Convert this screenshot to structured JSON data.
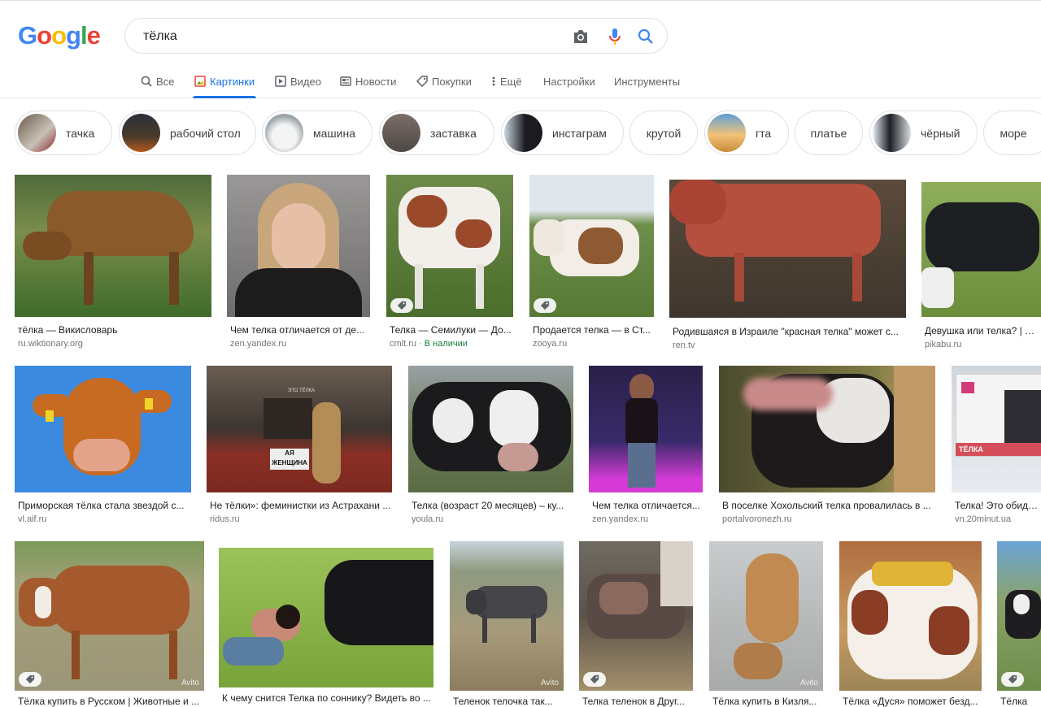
{
  "logo": [
    "G",
    "o",
    "o",
    "g",
    "l",
    "e"
  ],
  "logo_colors": [
    "#4285f4",
    "#ea4335",
    "#fbbc05",
    "#4285f4",
    "#34a853",
    "#ea4335"
  ],
  "search": {
    "query": "тёлка",
    "icons": [
      "camera-icon",
      "mic-icon",
      "search-icon"
    ]
  },
  "tabs": [
    {
      "label": "Все",
      "icon": "search-icon"
    },
    {
      "label": "Картинки",
      "icon": "image-icon",
      "active": true
    },
    {
      "label": "Видео",
      "icon": "video-icon"
    },
    {
      "label": "Новости",
      "icon": "news-icon"
    },
    {
      "label": "Покупки",
      "icon": "tag-icon"
    },
    {
      "label": "Ещё",
      "icon": "more-vert-icon"
    },
    {
      "label": "Настройки"
    },
    {
      "label": "Инструменты"
    }
  ],
  "chips": [
    {
      "label": "тачка"
    },
    {
      "label": "рабочий стол"
    },
    {
      "label": "машина"
    },
    {
      "label": "заставка"
    },
    {
      "label": "инстаграм"
    },
    {
      "label": "крутой"
    },
    {
      "label": "гта"
    },
    {
      "label": "платье"
    },
    {
      "label": "чёрный"
    },
    {
      "label": "море"
    }
  ],
  "results": [
    {
      "caption": "тёлка — Викисловарь",
      "source": "ru.wiktionary.org"
    },
    {
      "caption": "Чем телка отличается от де...",
      "source": "zen.yandex.ru"
    },
    {
      "caption": "Телка — Семилуки — До...",
      "source": "cmlt.ru",
      "stock": "В наличии"
    },
    {
      "caption": "Продается телка — в Ст...",
      "source": "zooya.ru"
    },
    {
      "caption": "Родившаяся в Израиле \"красная телка\" может с...",
      "source": "ren.tv"
    },
    {
      "caption": "Девушка или телка? | Пик",
      "source": "pikabu.ru"
    },
    {
      "caption": "Приморская тёлка стала звездой с...",
      "source": "vl.aif.ru"
    },
    {
      "caption": "Не тёлки»: феминистки из Астрахани ...",
      "source": "ridus.ru"
    },
    {
      "caption": "Телка (возраст 20 месяцев) – ку...",
      "source": "youla.ru"
    },
    {
      "caption": "Чем телка отличается...",
      "source": "zen.yandex.ru"
    },
    {
      "caption": "В поселке Хохольский телка провалилась в ...",
      "source": "portalvoronezh.ru"
    },
    {
      "caption": "Телка! Это обидно?",
      "source": "vn.20minut.ua"
    },
    {
      "caption": "Тёлка купить в Русском | Животные и ...",
      "source": ""
    },
    {
      "caption": "К чему снится Телка по соннику? Видеть во ...",
      "source": ""
    },
    {
      "caption": "Теленок телочка так...",
      "source": ""
    },
    {
      "caption": "Телка теленок в Друг...",
      "source": ""
    },
    {
      "caption": "Тёлка купить в Кизля...",
      "source": ""
    },
    {
      "caption": "Тёлка «Дуся» поможет безд...",
      "source": ""
    },
    {
      "caption": "Тёлка",
      "source": ""
    }
  ],
  "image_texts": {
    "sign1": "АЯ",
    "sign2": "ЖЕНЩИНА",
    "sign3": "ЭТО ТЁЛКА",
    "billboard": "ТЁЛКА",
    "watermark": "Avito"
  }
}
